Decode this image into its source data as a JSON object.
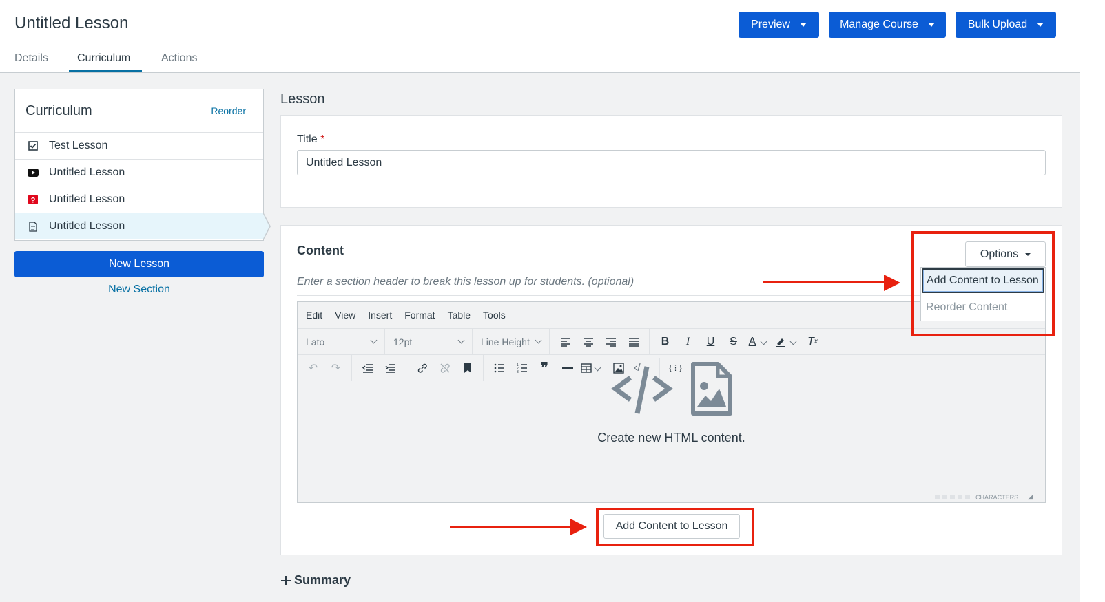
{
  "header": {
    "title": "Untitled Lesson",
    "tabs": [
      "Details",
      "Curriculum",
      "Actions"
    ],
    "buttons": {
      "preview": "Preview",
      "manage_course": "Manage Course",
      "bulk_upload": "Bulk Upload"
    }
  },
  "sidebar": {
    "title": "Curriculum",
    "reorder": "Reorder",
    "items": [
      {
        "label": "Test Lesson",
        "icon": "checkbox-icon"
      },
      {
        "label": "Untitled Lesson",
        "icon": "video-icon"
      },
      {
        "label": "Untitled Lesson",
        "icon": "quiz-icon"
      },
      {
        "label": "Untitled Lesson",
        "icon": "document-icon"
      }
    ],
    "new_lesson": "New Lesson",
    "new_section": "New Section"
  },
  "lesson": {
    "heading": "Lesson",
    "title_label": "Title",
    "required_mark": "*",
    "title_value": "Untitled Lesson"
  },
  "content": {
    "label": "Content",
    "section_hint": "Enter a section header to break this lesson up for students. (optional)",
    "options": "Options",
    "dropdown": [
      "Add Content to Lesson",
      "Reorder Content"
    ],
    "editor": {
      "menu": [
        "Edit",
        "View",
        "Insert",
        "Format",
        "Table",
        "Tools"
      ],
      "font": "Lato",
      "size": "12pt",
      "line_height": "Line Height",
      "placeholder": "Create new HTML content.",
      "status": "CHARACTERS"
    },
    "add_button": "Add Content to Lesson"
  },
  "summary": {
    "label": "Summary"
  },
  "colors": {
    "primary": "#0b5cd5",
    "link": "#0770a3",
    "annotation": "#e8210f"
  }
}
